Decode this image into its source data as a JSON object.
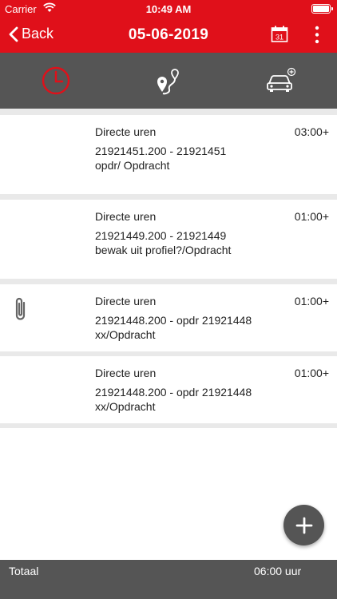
{
  "status_bar": {
    "carrier": "Carrier",
    "time": "10:49 AM"
  },
  "nav": {
    "back_label": "Back",
    "title": "05-06-2019",
    "calendar_day": "31"
  },
  "tabs": [
    {
      "name": "hours",
      "icon": "clock-icon",
      "active": true
    },
    {
      "name": "route",
      "icon": "route-pin-icon",
      "active": false
    },
    {
      "name": "vehicle",
      "icon": "car-add-icon",
      "active": false
    }
  ],
  "entries": [
    {
      "type": "Directe uren",
      "description": "21921451.200 - 21921451 opdr/ Opdracht",
      "hours": "03:00+",
      "attachment": false
    },
    {
      "type": "Directe uren",
      "description": "21921449.200 - 21921449 bewak uit profiel?/Opdracht",
      "hours": "01:00+",
      "attachment": false
    },
    {
      "type": "Directe uren",
      "description": "21921448.200 - opdr 21921448 xx/Opdracht",
      "hours": "01:00+",
      "attachment": true
    },
    {
      "type": "Directe uren",
      "description": "21921448.200 - opdr 21921448 xx/Opdracht",
      "hours": "01:00+",
      "attachment": false
    }
  ],
  "footer": {
    "label": "Totaal",
    "total": "06:00 uur"
  },
  "colors": {
    "brand_red": "#e0101a",
    "bar_gray": "#555555",
    "background": "#e9e9e9"
  }
}
